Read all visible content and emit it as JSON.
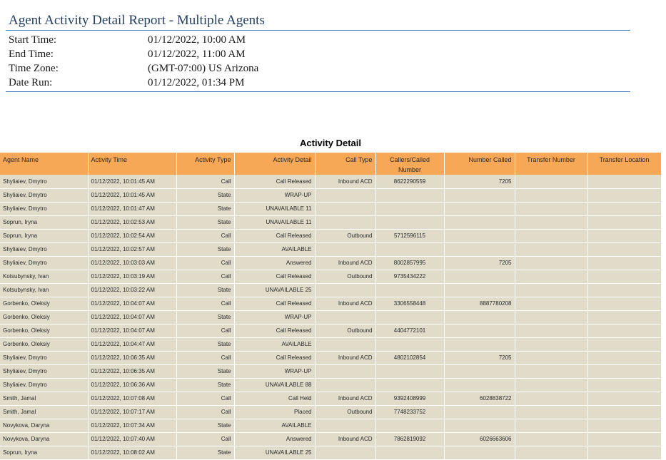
{
  "report": {
    "title": "Agent Activity Detail Report - Multiple Agents",
    "meta": [
      {
        "label": "Start Time:",
        "value": "01/12/2022, 10:00 AM"
      },
      {
        "label": "End Time:",
        "value": "01/12/2022, 11:00 AM"
      },
      {
        "label": "Time Zone:",
        "value": "(GMT-07:00) US Arizona"
      },
      {
        "label": "Date Run:",
        "value": "01/12/2022, 01:34 PM"
      }
    ]
  },
  "section_title": "Activity Detail",
  "columns": [
    "Agent Name",
    "Activity Time",
    "Activity Type",
    "Activity Detail",
    "Call Type",
    "Callers/Called Number",
    "Number Called",
    "Transfer Number",
    "Transfer Location"
  ],
  "rows": [
    [
      "Shyliaiev, Dmytro",
      "01/12/2022, 10:01:45 AM",
      "Call",
      "Call Released",
      "Inbound ACD",
      "8622290559",
      "7205",
      "",
      ""
    ],
    [
      "Shyliaiev, Dmytro",
      "01/12/2022, 10:01:45 AM",
      "State",
      "WRAP-UP",
      "",
      "",
      "",
      "",
      ""
    ],
    [
      "Shyliaiev, Dmytro",
      "01/12/2022, 10:01:47 AM",
      "State",
      "UNAVAILABLE 11",
      "",
      "",
      "",
      "",
      ""
    ],
    [
      "Soprun, Iryna",
      "01/12/2022, 10:02:53 AM",
      "State",
      "UNAVAILABLE 11",
      "",
      "",
      "",
      "",
      ""
    ],
    [
      "Soprun, Iryna",
      "01/12/2022, 10:02:54 AM",
      "Call",
      "Call Released",
      "Outbound",
      "5712596115",
      "",
      "",
      ""
    ],
    [
      "Shyliaiev, Dmytro",
      "01/12/2022, 10:02:57 AM",
      "State",
      "AVAILABLE",
      "",
      "",
      "",
      "",
      ""
    ],
    [
      "Shyliaiev, Dmytro",
      "01/12/2022, 10:03:03 AM",
      "Call",
      "Answered",
      "Inbound ACD",
      "8002857995",
      "7205",
      "",
      ""
    ],
    [
      "Kotsubynsky, Ivan",
      "01/12/2022, 10:03:19 AM",
      "Call",
      "Call Released",
      "Outbound",
      "9735434222",
      "",
      "",
      ""
    ],
    [
      "Kotsubynsky, Ivan",
      "01/12/2022, 10:03:22 AM",
      "State",
      "UNAVAILABLE 25",
      "",
      "",
      "",
      "",
      ""
    ],
    [
      "Gorbenko, Oleksiy",
      "01/12/2022, 10:04:07 AM",
      "Call",
      "Call Released",
      "Inbound ACD",
      "3306558448",
      "8887780208",
      "",
      ""
    ],
    [
      "Gorbenko, Oleksiy",
      "01/12/2022, 10:04:07 AM",
      "State",
      "WRAP-UP",
      "",
      "",
      "",
      "",
      ""
    ],
    [
      "Gorbenko, Oleksiy",
      "01/12/2022, 10:04:07 AM",
      "Call",
      "Call Released",
      "Outbound",
      "4404772101",
      "",
      "",
      ""
    ],
    [
      "Gorbenko, Oleksiy",
      "01/12/2022, 10:04:47 AM",
      "State",
      "AVAILABLE",
      "",
      "",
      "",
      "",
      ""
    ],
    [
      "Shyliaiev, Dmytro",
      "01/12/2022, 10:06:35 AM",
      "Call",
      "Call Released",
      "Inbound ACD",
      "4802102854",
      "7205",
      "",
      ""
    ],
    [
      "Shyliaiev, Dmytro",
      "01/12/2022, 10:06:35 AM",
      "State",
      "WRAP-UP",
      "",
      "",
      "",
      "",
      ""
    ],
    [
      "Shyliaiev, Dmytro",
      "01/12/2022, 10:06:36 AM",
      "State",
      "UNAVAILABLE 88",
      "",
      "",
      "",
      "",
      ""
    ],
    [
      "Smith, Jamal",
      "01/12/2022, 10:07:08 AM",
      "Call",
      "Call Held",
      "Inbound ACD",
      "9392408999",
      "6028838722",
      "",
      ""
    ],
    [
      "Smith, Jamal",
      "01/12/2022, 10:07:17 AM",
      "Call",
      "Placed",
      "Outbound",
      "7748233752",
      "",
      "",
      ""
    ],
    [
      "Novykova, Daryna",
      "01/12/2022, 10:07:34 AM",
      "State",
      "AVAILABLE",
      "",
      "",
      "",
      "",
      ""
    ],
    [
      "Novykova, Daryna",
      "01/12/2022, 10:07:40 AM",
      "Call",
      "Answered",
      "Inbound ACD",
      "7862819092",
      "6026663606",
      "",
      ""
    ],
    [
      "Soprun, Iryna",
      "01/12/2022, 10:08:02 AM",
      "State",
      "UNAVAILABLE 25",
      "",
      "",
      "",
      "",
      ""
    ]
  ]
}
